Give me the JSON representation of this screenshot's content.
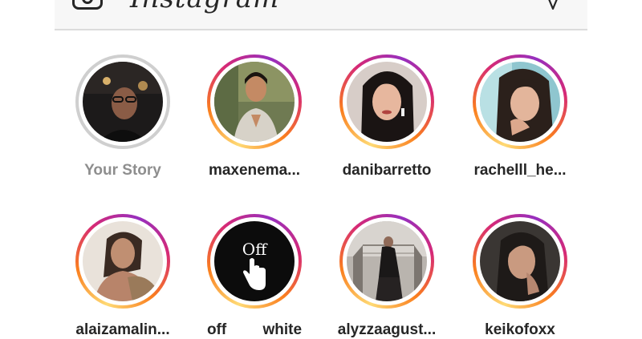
{
  "header": {
    "wordmark": "Instagram",
    "camera_icon": "camera-icon",
    "direct_icon": "paper-plane-icon"
  },
  "stories": [
    {
      "username": "Your Story",
      "seen": true
    },
    {
      "username": "maxenema...",
      "seen": false
    },
    {
      "username": "danibarretto",
      "seen": false
    },
    {
      "username": "rachelll_he...",
      "seen": false
    },
    {
      "username": "alaizamalin...",
      "seen": false
    },
    {
      "username": "off white",
      "seen": false
    },
    {
      "username": "alyzzaagust...",
      "seen": false
    },
    {
      "username": "keikofoxx",
      "seen": false
    }
  ],
  "colors": {
    "ring_gradient": [
      "#feda75",
      "#fa7e1e",
      "#d62976",
      "#962fbf"
    ],
    "seen_ring": "#cfcfcf",
    "text": "#262626",
    "muted_text": "#8e8e8e"
  }
}
